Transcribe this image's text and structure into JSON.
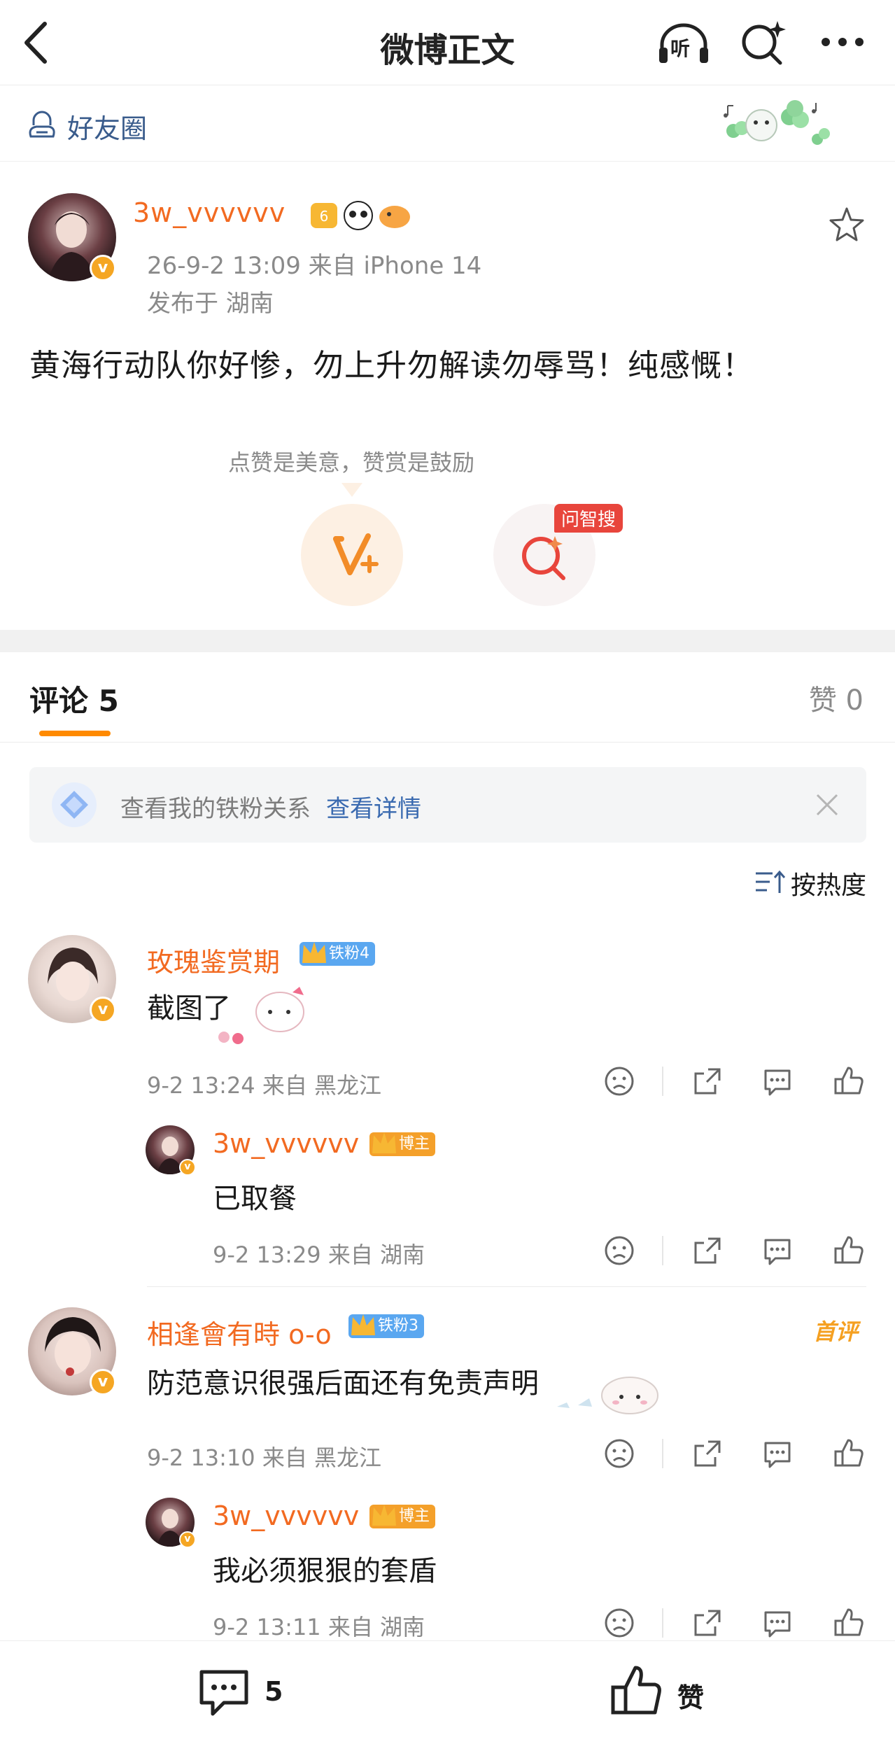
{
  "header": {
    "title": "微博正文",
    "listen_label": "听"
  },
  "friends_circle": {
    "label": "好友圈"
  },
  "post": {
    "username": "3w_vvvvvv",
    "time_source": "26-9-2 13:09  来自 iPhone 14",
    "location": "发布于 湖南",
    "content": "黄海行动队你好惨，勿上升勿解读勿辱骂！纯感慨！",
    "like_hint": "点赞是美意，赞赏是鼓励",
    "zhisou_tag": "问智搜",
    "verified_badge": "v"
  },
  "tabs": {
    "comments_label": "评论 5",
    "likes_label": "赞 0"
  },
  "fan_banner": {
    "text": "查看我的铁粉关系",
    "link": "查看详情"
  },
  "sort": {
    "label": "按热度"
  },
  "comments": [
    {
      "name": "玫瑰鉴赏期",
      "badge": "铁粉4",
      "text": "截图了",
      "meta": "9-2 13:24  来自 黑龙江",
      "replies": [
        {
          "name": "3w_vvvvvv",
          "badge": "博主",
          "text": "已取餐",
          "meta": "9-2 13:29  来自 湖南"
        }
      ]
    },
    {
      "name": "相逢會有時 o-o",
      "badge": "铁粉3",
      "first_tag": "首评",
      "text": "防范意识很强后面还有免责声明",
      "meta": "9-2 13:10  来自 黑龙江",
      "replies": [
        {
          "name": "3w_vvvvvv",
          "badge": "博主",
          "text": "我必须狠狠的套盾",
          "meta": "9-2 13:11  来自 湖南"
        }
      ]
    }
  ],
  "bottom_bar": {
    "comment_count": "5",
    "like_label": "赞"
  },
  "colors": {
    "username": "#f26a21",
    "link": "#3a6ab0",
    "accent": "#ff8a00",
    "fan_badge": "#5aa7f0",
    "owner_badge": "#f4a02a"
  }
}
